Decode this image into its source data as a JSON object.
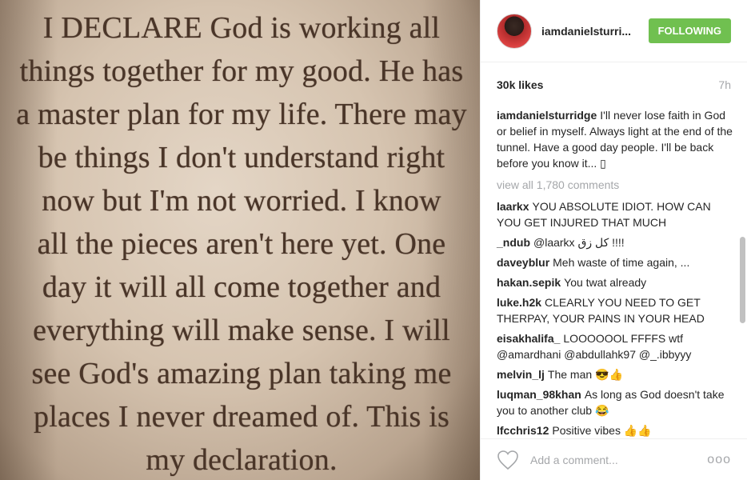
{
  "photo": {
    "quote": "I DECLARE God is working all\nthings together for my good. He has\na master plan for my life. There may\nbe things I don't understand right\nnow but I'm not worried. I know\nall the pieces aren't here yet. One\nday it will all come together and\neverything will make sense. I will\nsee God's amazing plan taking me\nplaces I never dreamed of. This is\nmy declaration."
  },
  "header": {
    "username": "iamdanielsturri...",
    "follow_label": "FOLLOWING"
  },
  "meta": {
    "likes": "30k likes",
    "time": "7h"
  },
  "caption": {
    "user": "iamdanielsturridge",
    "text": "I'll never lose faith in God or belief in myself. Always light at the end of the tunnel. Have a good day people. I'll be back before you know it... ▯"
  },
  "view_all": "view all 1,780 comments",
  "comments": [
    {
      "user": "laarkx",
      "text": "YOU ABSOLUTE IDIOT. HOW CAN YOU GET INJURED THAT MUCH"
    },
    {
      "user": "_ndub",
      "text": "@laarkx كل زق !!!!"
    },
    {
      "user": "daveyblur",
      "text": "Meh waste of time again, ..."
    },
    {
      "user": "hakan.sepik",
      "text": "You twat already"
    },
    {
      "user": "luke.h2k",
      "text": "CLEARLY YOU NEED TO GET THERPAY, YOUR PAINS IN YOUR HEAD"
    },
    {
      "user": "eisakhalifa_",
      "text": "LOOOOOOL FFFFS wtf @amardhani @abdullahk97 @_.ibbyyy"
    },
    {
      "user": "melvin_lj",
      "text": "The man 😎👍"
    },
    {
      "user": "luqman_98khan",
      "text": "As long as God doesn't take you to another club 😂"
    },
    {
      "user": "lfcchris12",
      "text": "Positive vibes 👍👍"
    }
  ],
  "footer": {
    "placeholder": "Add a comment...",
    "more_label": "ooo",
    "like_icon": "heart-icon"
  },
  "colors": {
    "follow_button": "#70c050",
    "muted_text": "#a5a7aa",
    "quote_ink": "#4a3528"
  }
}
